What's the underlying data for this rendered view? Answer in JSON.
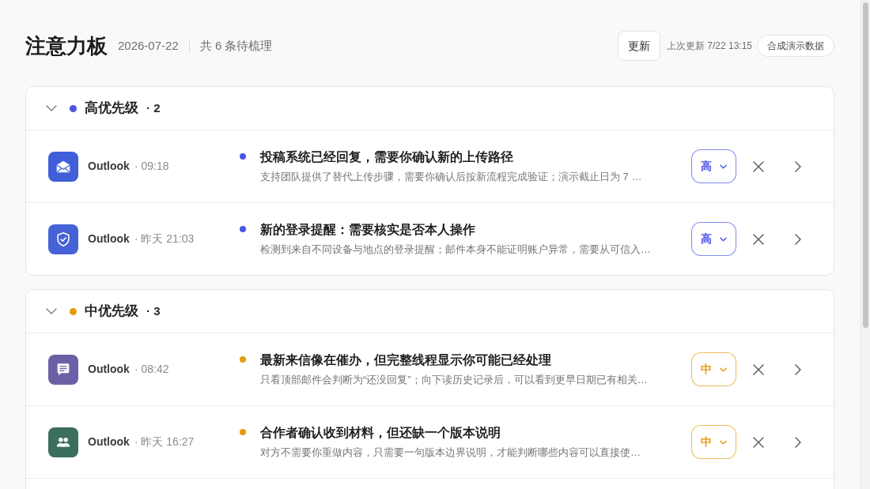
{
  "header": {
    "title": "注意力板",
    "date": "2026-07-22",
    "summary": "共 6 条待梳理",
    "refresh_button": "更新",
    "last_updated": "上次更新 7/22 13:15",
    "data_tag": "合成演示数据"
  },
  "groups": [
    {
      "label": "高优先级",
      "count": "· 2",
      "color": "#4a55e6",
      "expanded": true,
      "items": [
        {
          "kind": "mail",
          "color": "#3f5ed8",
          "source": "Outlook",
          "time": "· 09:18",
          "title": "投稿系统已经回复，需要你确认新的上传路径",
          "snippet": "支持团队提供了替代上传步骤，需要你确认后按新流程完成验证；演示截止日为 7 …",
          "priority": {
            "label": "高",
            "color": "#4a55e6"
          }
        },
        {
          "kind": "shield",
          "color": "#4562d6",
          "source": "Outlook",
          "time": "· 昨天 21:03",
          "title": "新的登录提醒：需要核实是否本人操作",
          "snippet": "检测到来自不同设备与地点的登录提醒；邮件本身不能证明账户异常，需要从可信入…",
          "priority": {
            "label": "高",
            "color": "#4a55e6"
          }
        }
      ]
    },
    {
      "label": "中优先级",
      "count": "· 3",
      "color": "#e59c0b",
      "expanded": true,
      "items": [
        {
          "kind": "chat",
          "color": "#6d5fa6",
          "source": "Outlook",
          "time": "· 08:42",
          "title": "最新来信像在催办，但完整线程显示你可能已经处理",
          "snippet": "只看顶部邮件会判断为“还没回复”；向下读历史记录后，可以看到更早日期已有相关…",
          "priority": {
            "label": "中",
            "color": "#e59c0b"
          }
        },
        {
          "kind": "people",
          "color": "#3b6e5e",
          "source": "Outlook",
          "time": "· 昨天 16:27",
          "title": "合作者确认收到材料，但还缺一个版本说明",
          "snippet": "对方不需要你重做内容，只需要一句版本边界说明，才能判断哪些内容可以直接使…",
          "priority": {
            "label": "中",
            "color": "#e59c0b"
          }
        }
      ]
    }
  ]
}
